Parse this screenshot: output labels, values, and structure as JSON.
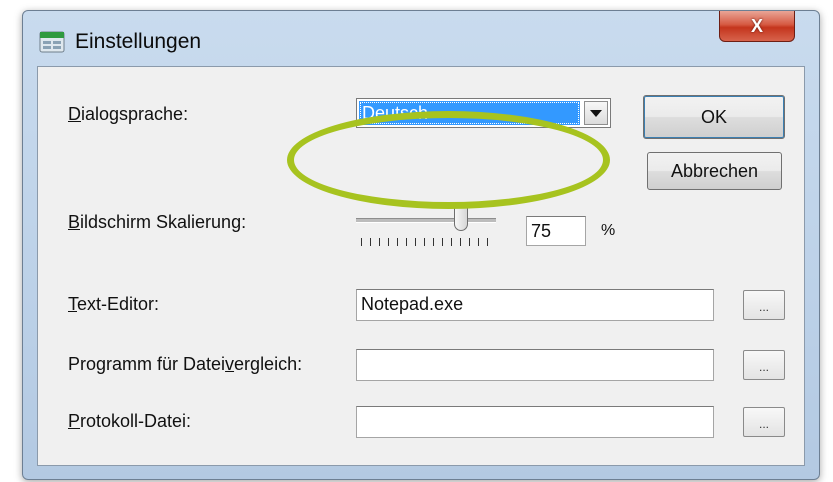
{
  "window": {
    "title": "Einstellungen",
    "close_glyph": "X"
  },
  "fields": {
    "language": {
      "label_accel": "D",
      "label_rest": "ialogsprache:",
      "selected": "Deutsch"
    },
    "scaling": {
      "label_accel": "B",
      "label_rest": "ildschirm Skalierung:",
      "value": "75",
      "unit": "%"
    },
    "text_editor": {
      "label_accel": "T",
      "label_rest": "ext-Editor:",
      "value": "Notepad.exe",
      "browse": "..."
    },
    "compare": {
      "label_pre": "Programm für Datei",
      "label_accel": "v",
      "label_post": "ergleich:",
      "value": "",
      "browse": "..."
    },
    "log_file": {
      "label_accel": "P",
      "label_rest": "rotokoll-Datei:",
      "value": "",
      "browse": "..."
    }
  },
  "buttons": {
    "ok": "OK",
    "cancel": "Abbrechen"
  },
  "highlight_color": "#a7c31f",
  "selection_color": "#3399ff"
}
